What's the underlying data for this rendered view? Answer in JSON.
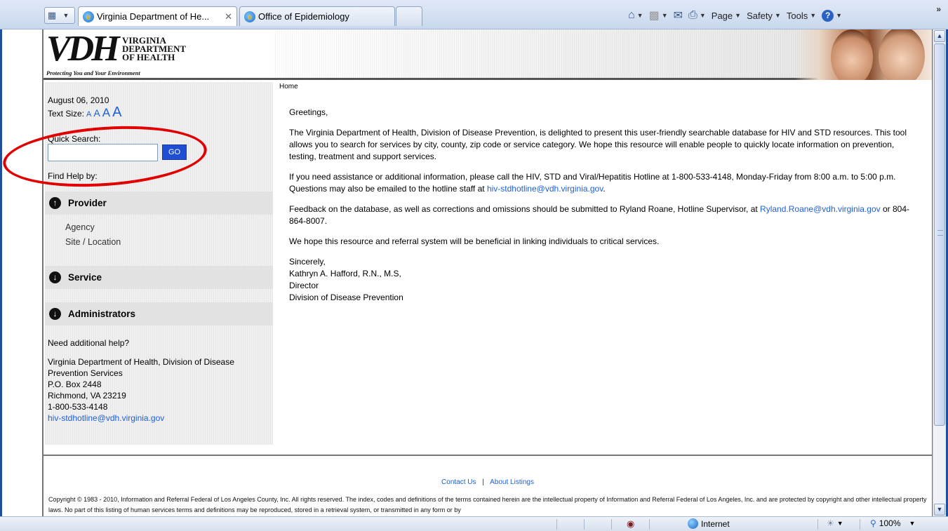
{
  "browser": {
    "tabs": [
      {
        "label": "Virginia Department of He...",
        "active": true
      },
      {
        "label": "Office of Epidemiology",
        "active": false
      }
    ],
    "command_bar": {
      "page_label": "Page",
      "safety_label": "Safety",
      "tools_label": "Tools"
    },
    "status": {
      "zone": "Internet",
      "zoom": "100%"
    }
  },
  "header": {
    "logo_letters": "VDH",
    "logo_lines": [
      "VIRGINIA",
      "DEPARTMENT",
      "OF HEALTH"
    ],
    "tagline": "Protecting You and Your Environment"
  },
  "breadcrumb": "Home",
  "sidebar": {
    "date": "August 06, 2010",
    "text_size_label": "Text Size:",
    "text_size_options": [
      "A",
      "A",
      "A",
      "A"
    ],
    "quick_search_label": "Quick Search:",
    "search_value": "",
    "go_label": "GO",
    "find_help_label": "Find Help by:",
    "sections": [
      {
        "label": "Provider",
        "expanded": true,
        "items": [
          "Agency",
          "Site / Location"
        ]
      },
      {
        "label": "Service",
        "expanded": false,
        "items": []
      },
      {
        "label": "Administrators",
        "expanded": false,
        "items": []
      }
    ],
    "help_title": "Need additional help?",
    "help_lines": [
      "Virginia Department of Health, Division of Disease",
      "Prevention Services",
      "P.O. Box 2448",
      "Richmond, VA 23219",
      "1-800-533-4148"
    ],
    "help_email": "hiv-stdhotline@vdh.virginia.gov"
  },
  "main": {
    "greeting": "Greetings,",
    "para1": "The Virginia Department of Health, Division of Disease Prevention, is delighted to present this user-friendly searchable database for HIV and STD resources. This tool allows you to search for services by city, county, zip code or service category. We hope this resource will enable people to quickly locate information on prevention, testing, treatment and support services.",
    "para2_text": "If you need assistance or additional information, please call the HIV, STD and Viral/Hepatitis Hotline at 1-800-533-4148, Monday-Friday from 8:00 a.m. to 5:00 p.m. Questions may also be emailed to the hotline staff at ",
    "para2_link": "hiv-stdhotline@vdh.virginia.gov",
    "para2_end": ".",
    "para3_text": "Feedback on the database, as well as corrections and omissions should be submitted to Ryland Roane, Hotline Supervisor, at ",
    "para3_link": "Ryland.Roane@vdh.virginia.gov",
    "para3_end": " or 804-864-8007.",
    "para4": "We hope this resource and referral system will be beneficial in linking individuals to critical services.",
    "signature": [
      "Sincerely,",
      "Kathryn A. Hafford, R.N., M.S,",
      "Director",
      "Division of Disease Prevention"
    ]
  },
  "footer": {
    "contact_label": "Contact Us",
    "separator": "|",
    "about_label": "About Listings",
    "copyright": "Copyright © 1983 - 2010, Information and Referral Federal of Los Angeles County, Inc. All rights reserved. The index, codes and definitions of the terms contained herein are the intellectual property of Information and Referral Federal of Los Angeles, Inc. and are protected by copyright and other intellectual property laws. No part of this listing of human services terms and definitions may be reproduced, stored in a retrieval system, or transmitted in any form or by"
  }
}
